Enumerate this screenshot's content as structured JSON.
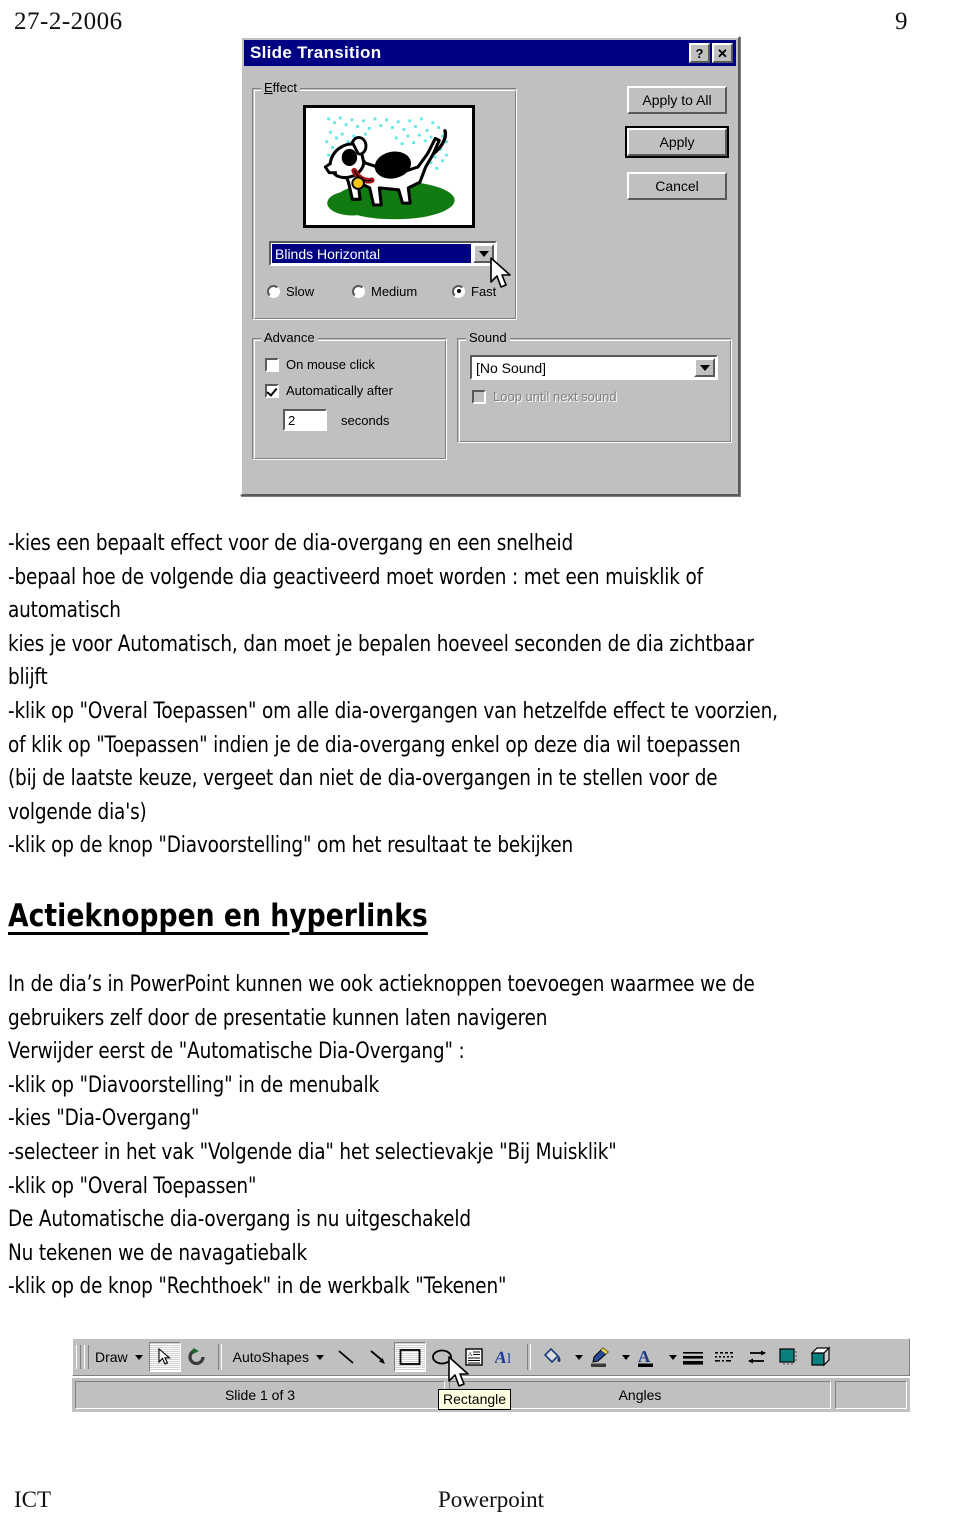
{
  "header": {
    "date": "27-2-2006",
    "page_number": "9"
  },
  "dialog": {
    "title": "Slide Transition",
    "help_button": "?",
    "close_button": "✕",
    "effect_group": {
      "label": "Effect",
      "preview_alt": "dog-clipart-preview",
      "selected_effect": "Blinds Horizontal",
      "speeds": [
        {
          "label": "Slow",
          "selected": false
        },
        {
          "label": "Medium",
          "selected": false
        },
        {
          "label": "Fast",
          "selected": true
        }
      ]
    },
    "advance_group": {
      "label": "Advance",
      "on_mouse_click": {
        "label": "On mouse click",
        "checked": false
      },
      "automatically_after": {
        "label": "Automatically after",
        "checked": true
      },
      "seconds_value": "2",
      "seconds_label": "seconds"
    },
    "sound_group": {
      "label": "Sound",
      "selected_sound": "[No Sound]",
      "loop_until_next_sound": {
        "label": "Loop until next sound",
        "checked": false,
        "disabled": true
      }
    },
    "buttons": {
      "apply_to_all": "Apply to All",
      "apply": "Apply",
      "cancel": "Cancel"
    },
    "colors": {
      "titlebar": "#000082",
      "face": "#c0c0c0",
      "highlight_text": "#ffffff",
      "disabled_text": "#808080"
    }
  },
  "body_lines_1": [
    "-kies een bepaalt effect voor de dia-overgang en een snelheid",
    "-bepaal hoe de volgende dia geactiveerd moet worden : met een muisklik of",
    "automatisch",
    "kies je voor Automatisch, dan moet je bepalen hoeveel seconden de dia zichtbaar",
    "blijft",
    "-klik op \"Overal Toepassen\" om alle dia-overgangen van hetzelfde effect te voorzien,",
    "of klik op \"Toepassen\" indien je de dia-overgang enkel op deze dia wil toepassen",
    "(bij de laatste keuze, vergeet dan niet de dia-overgangen in te stellen voor de",
    "volgende dia's)",
    "-klik op de knop \"Diavoorstelling\" om het resultaat te bekijken"
  ],
  "section_heading": "Actieknoppen en hyperlinks",
  "body_lines_2": [
    "In de dia’s in PowerPoint kunnen we ook actieknoppen toevoegen waarmee we de",
    "gebruikers zelf door de presentatie kunnen laten navigeren",
    "Verwijder eerst de \"Automatische Dia-Overgang\" :",
    "-klik op \"Diavoorstelling\" in de menubalk",
    "-kies \"Dia-Overgang\"",
    "-selecteer in het vak \"Volgende dia\" het selectievakje \"Bij Muisklik\"",
    "-klik op \"Overal Toepassen\"",
    "De Automatische dia-overgang is nu uitgeschakeld",
    "Nu tekenen we de navagatiebalk",
    "-klik op de knop \"Rechthoek\" in de werkbalk \"Tekenen\""
  ],
  "drawing_toolbar": {
    "draw_menu": "Draw",
    "autoshapes_menu": "AutoShapes",
    "tooltip": "Rectangle",
    "status": {
      "slide_counter": "Slide 1 of 3",
      "design_name": "Angles",
      "extra": ""
    },
    "icons": [
      "select-arrow-icon",
      "free-rotate-icon",
      "line-icon",
      "arrow-icon",
      "rectangle-icon",
      "oval-icon",
      "text-box-icon",
      "wordart-icon",
      "fill-color-icon",
      "line-color-icon",
      "font-color-icon",
      "line-style-icon",
      "dash-style-icon",
      "arrow-style-icon",
      "shadow-icon",
      "3d-icon"
    ]
  },
  "footer": {
    "left": "ICT",
    "center": "Powerpoint"
  }
}
